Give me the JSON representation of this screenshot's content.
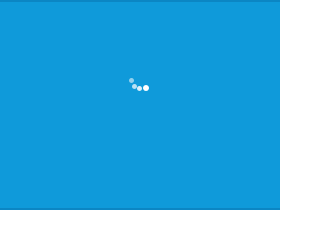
{
  "screen": {
    "background_color": "#0f9ada",
    "edge_color": "#0b86c4"
  },
  "spinner": {
    "icon": "loading-spinner-icon",
    "dot_color": "#ffffff",
    "dot_count": 4
  }
}
